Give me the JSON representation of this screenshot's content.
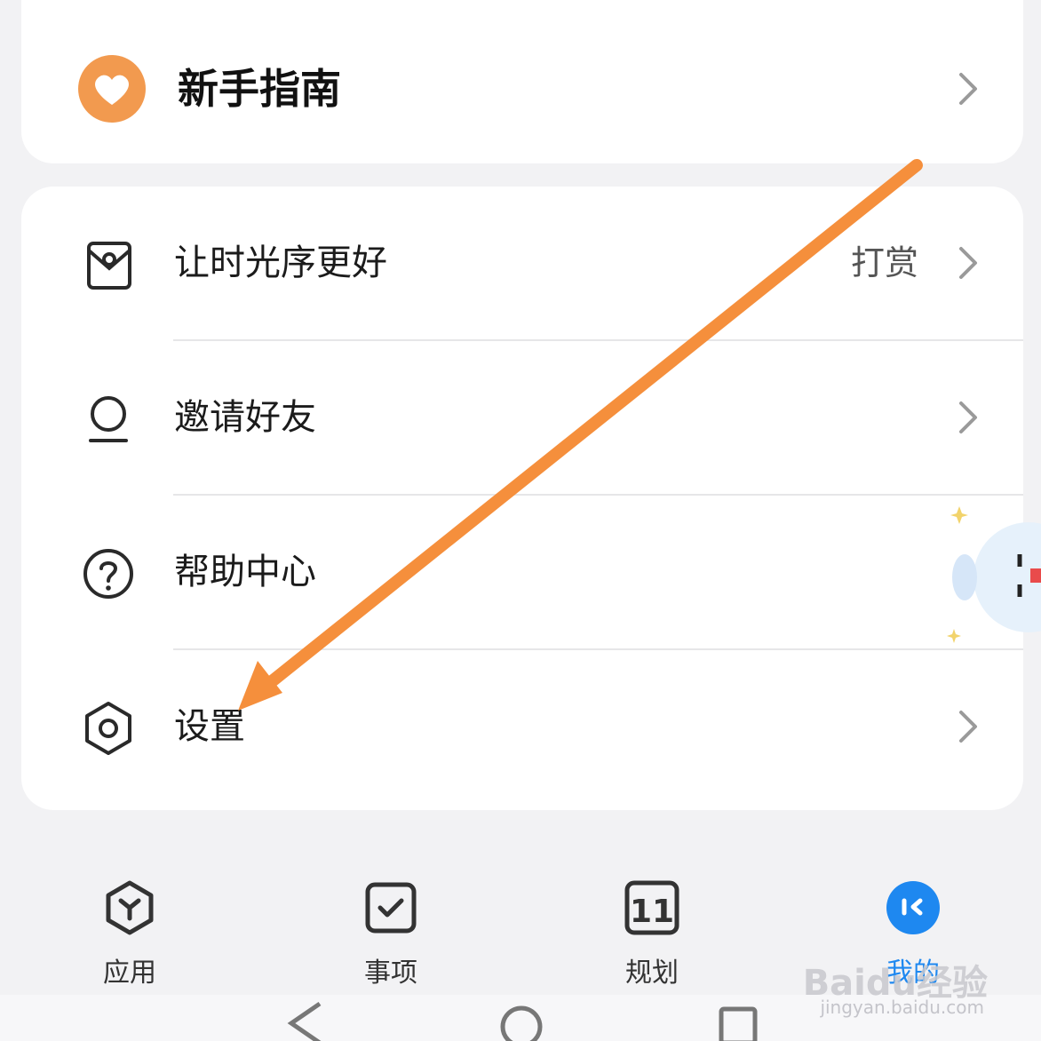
{
  "guide": {
    "label": "新手指南",
    "icon": "heart-icon",
    "color": "#f29a4f"
  },
  "menu": {
    "items": [
      {
        "label": "让时光序更好",
        "aux": "打赏",
        "icon": "gift-bag-icon"
      },
      {
        "label": "邀请好友",
        "aux": "",
        "icon": "person-icon"
      },
      {
        "label": "帮助中心",
        "aux": "",
        "icon": "help-icon"
      },
      {
        "label": "设置",
        "aux": "",
        "icon": "gear-icon"
      }
    ]
  },
  "tabs": [
    {
      "label": "应用",
      "icon": "apps-hexagon-icon",
      "active": false
    },
    {
      "label": "事项",
      "icon": "checkbox-icon",
      "active": false
    },
    {
      "label": "规划",
      "icon": "calendar-11-icon",
      "active": false,
      "badge": "11"
    },
    {
      "label": "我的",
      "icon": "profile-circle-icon",
      "active": true
    }
  ],
  "colors": {
    "accent": "#1e88f0",
    "arrow": "#f58f3c",
    "guide_icon": "#f29a4f"
  },
  "watermark": {
    "text": "Baidu经验",
    "sub": "jingyan.baidu.com"
  }
}
